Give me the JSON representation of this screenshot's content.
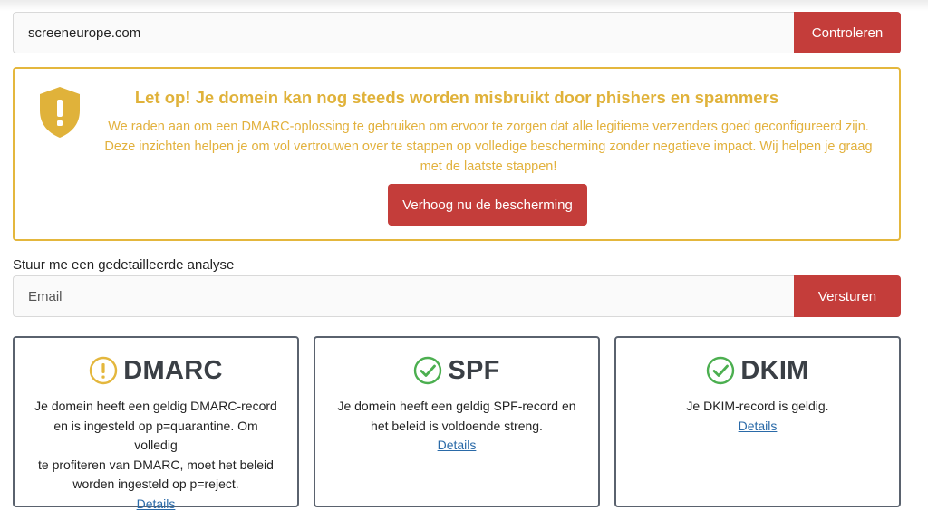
{
  "domain_check": {
    "value": "screeneurope.com",
    "button_label": "Controleren"
  },
  "alert": {
    "title": "Let op! Je domein kan nog steeds worden misbruikt door phishers en spammers",
    "line1": "We raden aan om een DMARC-oplossing te gebruiken om ervoor te zorgen dat alle legitieme verzenders goed geconfigureerd zijn.",
    "line2": "Deze inzichten helpen je om vol vertrouwen over te stappen op volledige bescherming zonder negatieve impact. Wij helpen je graag",
    "line3": "met de laatste stappen!",
    "cta_label": "Verhoog nu de bescherming",
    "accent_color": "#e0b23a"
  },
  "analysis": {
    "label": "Stuur me een gedetailleerde analyse",
    "placeholder": "Email",
    "button_label": "Versturen"
  },
  "cards": [
    {
      "title": "DMARC",
      "icon": "warning-circle-icon",
      "lines": [
        "Je domein heeft een geldig DMARC-record",
        "en is ingesteld op p=quarantine. Om volledig",
        "te profiteren van DMARC, moet het beleid",
        "worden ingesteld op p=reject."
      ],
      "link": "Details"
    },
    {
      "title": "SPF",
      "icon": "check-circle-icon",
      "lines": [
        "Je domein heeft een geldig SPF-record en",
        "het beleid is voldoende streng."
      ],
      "link": "Details"
    },
    {
      "title": "DKIM",
      "icon": "check-circle-icon",
      "lines": [
        "Je DKIM-record is geldig."
      ],
      "link": "Details"
    }
  ],
  "colors": {
    "primary_button": "#c43d3a",
    "warning": "#e4b73d",
    "success": "#4caf50",
    "link": "#2a6aa8"
  }
}
